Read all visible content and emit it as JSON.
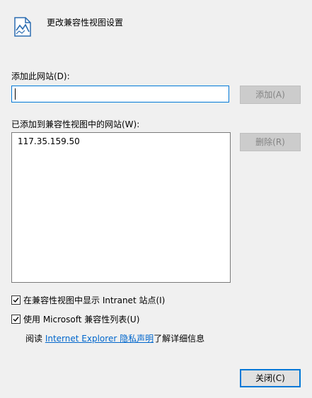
{
  "dialog": {
    "title": "更改兼容性视图设置",
    "icon": "compat-view-document-icon"
  },
  "add_site": {
    "label": "添加此网站(D):",
    "input_value": "",
    "add_button": "添加(A)"
  },
  "site_list": {
    "label": "已添加到兼容性视图中的网站(W):",
    "items": [
      "117.35.159.50"
    ],
    "remove_button": "删除(R)"
  },
  "options": {
    "intranet_checkbox": {
      "label": "在兼容性视图中显示 Intranet 站点(I)",
      "checked": true
    },
    "ms_list_checkbox": {
      "label": "使用 Microsoft 兼容性列表(U)",
      "checked": true
    }
  },
  "privacy": {
    "prefix": "阅读 ",
    "link_text": "Internet Explorer 隐私声明",
    "suffix": "了解详细信息"
  },
  "footer": {
    "close_button": "关闭(C)"
  },
  "colors": {
    "background": "#f0f0f0",
    "accent": "#0078d7",
    "link": "#0066cc",
    "disabled_text": "#838383"
  }
}
